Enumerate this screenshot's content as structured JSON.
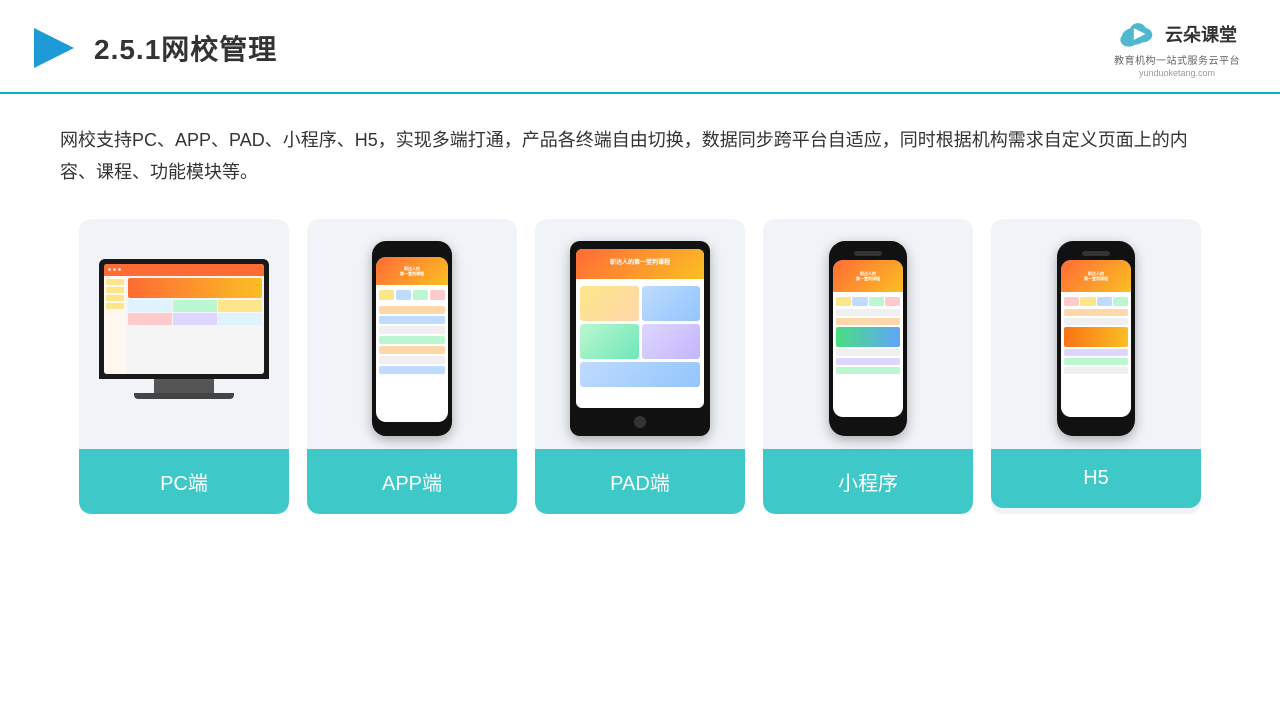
{
  "header": {
    "title": "2.5.1网校管理",
    "logo_name": "云朵课堂",
    "logo_tagline": "教育机构一站式服务云平台",
    "logo_url": "yunduoketang.com"
  },
  "description": {
    "text": "网校支持PC、APP、PAD、小程序、H5，实现多端打通，产品各终端自由切换，数据同步跨平台自适应，同时根据机构需求自定义页面上的内容、课程、功能模块等。"
  },
  "cards": [
    {
      "id": "pc",
      "label": "PC端"
    },
    {
      "id": "app",
      "label": "APP端"
    },
    {
      "id": "pad",
      "label": "PAD端"
    },
    {
      "id": "miniprogram",
      "label": "小程序"
    },
    {
      "id": "h5",
      "label": "H5"
    }
  ]
}
